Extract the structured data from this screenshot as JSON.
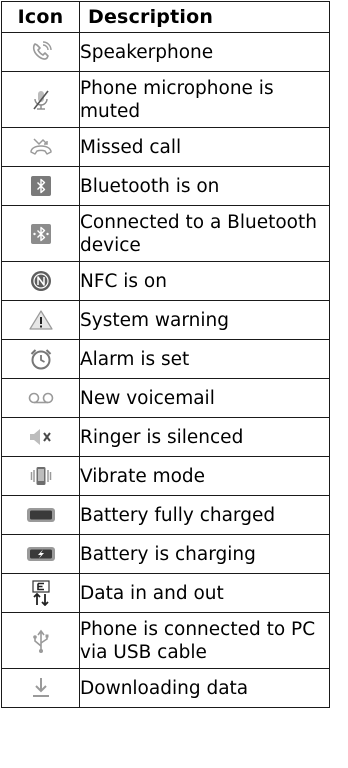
{
  "header": {
    "icon_label": "Icon",
    "description_label": "Description"
  },
  "rows": [
    {
      "icon": "speakerphone-icon",
      "description": "Speakerphone"
    },
    {
      "icon": "microphone-muted-icon",
      "description": "Phone microphone is muted"
    },
    {
      "icon": "missed-call-icon",
      "description": "Missed call"
    },
    {
      "icon": "bluetooth-icon",
      "description": "Bluetooth is on"
    },
    {
      "icon": "bluetooth-connected-icon",
      "description": "Connected to a Bluetooth device"
    },
    {
      "icon": "nfc-icon",
      "description": "NFC is on"
    },
    {
      "icon": "warning-icon",
      "description": "System warning"
    },
    {
      "icon": "alarm-icon",
      "description": "Alarm is set"
    },
    {
      "icon": "voicemail-icon",
      "description": "New voicemail"
    },
    {
      "icon": "ringer-silenced-icon",
      "description": "Ringer is silenced"
    },
    {
      "icon": "vibrate-icon",
      "description": "Vibrate mode"
    },
    {
      "icon": "battery-full-icon",
      "description": "Battery fully charged"
    },
    {
      "icon": "battery-charging-icon",
      "description": "Battery is charging"
    },
    {
      "icon": "data-in-out-icon",
      "description": "Data in and out"
    },
    {
      "icon": "usb-icon",
      "description": "Phone is connected to PC via USB cable"
    },
    {
      "icon": "download-icon",
      "description": "Downloading data"
    }
  ]
}
